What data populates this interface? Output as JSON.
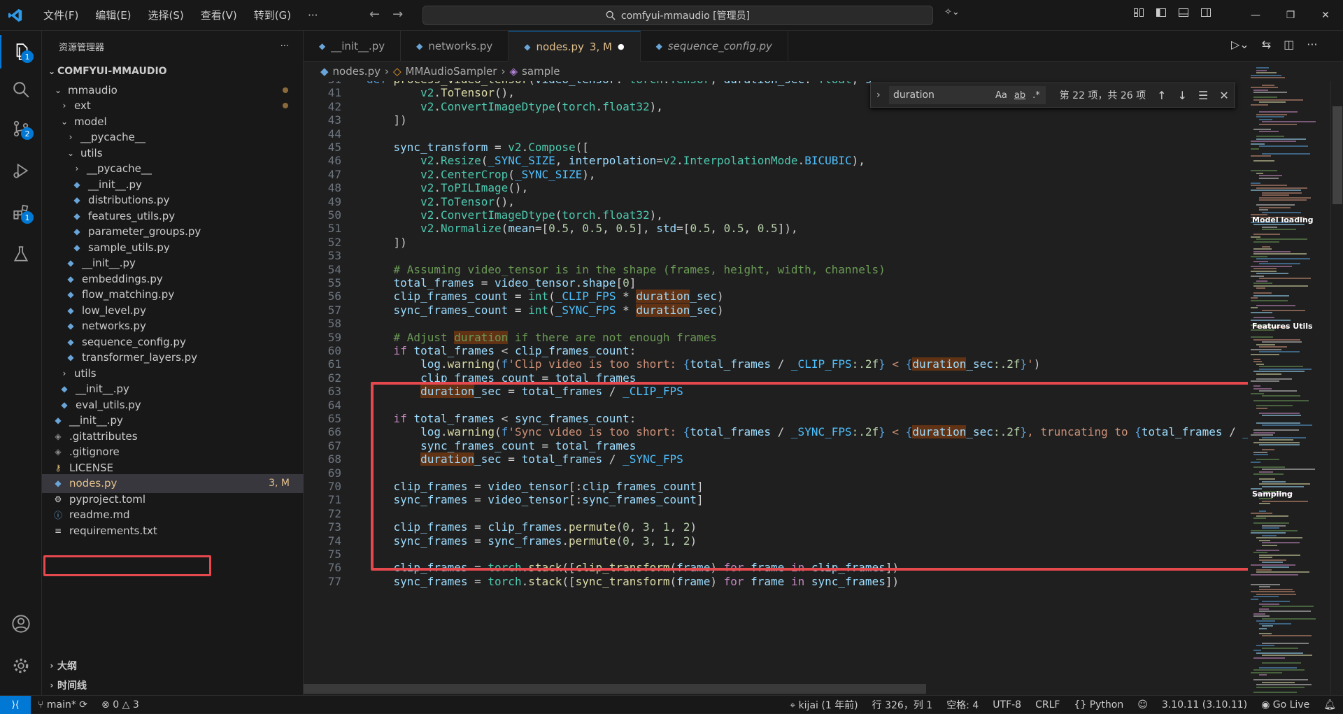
{
  "titlebar": {
    "menu": [
      "文件(F)",
      "编辑(E)",
      "选择(S)",
      "查看(V)",
      "转到(G)",
      "···"
    ],
    "search": "comfyui-mmaudio [管理员]"
  },
  "activity_badges": {
    "explorer": "1",
    "scm": "2",
    "extensions": "1"
  },
  "sidebar": {
    "title": "资源管理器",
    "more": "···",
    "root": "COMFYUI-MMAUDIO",
    "items": [
      {
        "label": "mmaudio",
        "indent": 1,
        "type": "folder-open",
        "dot": true
      },
      {
        "label": "ext",
        "indent": 2,
        "type": "folder",
        "dot": true
      },
      {
        "label": "model",
        "indent": 2,
        "type": "folder-open"
      },
      {
        "label": "__pycache__",
        "indent": 3,
        "type": "folder"
      },
      {
        "label": "utils",
        "indent": 3,
        "type": "folder-open"
      },
      {
        "label": "__pycache__",
        "indent": 4,
        "type": "folder"
      },
      {
        "label": "__init__.py",
        "indent": 4,
        "type": "py"
      },
      {
        "label": "distributions.py",
        "indent": 4,
        "type": "py"
      },
      {
        "label": "features_utils.py",
        "indent": 4,
        "type": "py"
      },
      {
        "label": "parameter_groups.py",
        "indent": 4,
        "type": "py"
      },
      {
        "label": "sample_utils.py",
        "indent": 4,
        "type": "py"
      },
      {
        "label": "__init__.py",
        "indent": 3,
        "type": "py"
      },
      {
        "label": "embeddings.py",
        "indent": 3,
        "type": "py"
      },
      {
        "label": "flow_matching.py",
        "indent": 3,
        "type": "py"
      },
      {
        "label": "low_level.py",
        "indent": 3,
        "type": "py"
      },
      {
        "label": "networks.py",
        "indent": 3,
        "type": "py"
      },
      {
        "label": "sequence_config.py",
        "indent": 3,
        "type": "py"
      },
      {
        "label": "transformer_layers.py",
        "indent": 3,
        "type": "py"
      },
      {
        "label": "utils",
        "indent": 2,
        "type": "folder"
      },
      {
        "label": "__init__.py",
        "indent": 2,
        "type": "py"
      },
      {
        "label": "eval_utils.py",
        "indent": 2,
        "type": "py"
      },
      {
        "label": "__init__.py",
        "indent": 1,
        "type": "py"
      },
      {
        "label": ".gitattributes",
        "indent": 1,
        "type": "git"
      },
      {
        "label": ".gitignore",
        "indent": 1,
        "type": "git"
      },
      {
        "label": "LICENSE",
        "indent": 1,
        "type": "license"
      },
      {
        "label": "nodes.py",
        "indent": 1,
        "type": "py",
        "selected": true,
        "status": "3, M"
      },
      {
        "label": "pyproject.toml",
        "indent": 1,
        "type": "gear"
      },
      {
        "label": "readme.md",
        "indent": 1,
        "type": "info"
      },
      {
        "label": "requirements.txt",
        "indent": 1,
        "type": "txt"
      }
    ],
    "outline": "大纲",
    "timeline": "时间线"
  },
  "tabs": [
    {
      "label": "__init__.py"
    },
    {
      "label": "networks.py"
    },
    {
      "label": "nodes.py",
      "status": "3, M",
      "active": true
    },
    {
      "label": "sequence_config.py",
      "italic": true
    }
  ],
  "breadcrumb": [
    "nodes.py",
    "MMAudioSampler",
    "sample"
  ],
  "find": {
    "query": "duration",
    "result": "第 22 项，共 26 项",
    "opts": [
      "Aa",
      "ab",
      ".*"
    ]
  },
  "code": [
    {
      "n": "31",
      "h": "<span class='kw'>def</span> <span class='fn'>process_video_tensor</span>(<span class='var'>video_tensor</span>: <span class='cls'>torch</span>.<span class='cls'>Tensor</span>, <span class='var'>duration_sec</span>: <span class='cls'>float</span>, <span class='var'>s</span>"
    },
    {
      "n": "41",
      "h": "        <span class='cls'>v2</span>.<span class='fn'>ToTensor</span>(),"
    },
    {
      "n": "42",
      "h": "        <span class='cls'>v2</span>.<span class='cls'>ConvertImageDtype</span>(<span class='cls'>torch</span>.<span class='cls'>float32</span>),"
    },
    {
      "n": "43",
      "h": "    ])"
    },
    {
      "n": "44",
      "h": ""
    },
    {
      "n": "45",
      "h": "    <span class='var'>sync_transform</span> = <span class='cls'>v2</span>.<span class='cls'>Compose</span>(["
    },
    {
      "n": "46",
      "h": "        <span class='cls'>v2</span>.<span class='cls'>Resize</span>(<span class='const'>_SYNC_SIZE</span>, <span class='var'>interpolation</span>=<span class='cls'>v2</span>.<span class='cls'>InterpolationMode</span>.<span class='const'>BICUBIC</span>),"
    },
    {
      "n": "47",
      "h": "        <span class='cls'>v2</span>.<span class='cls'>CenterCrop</span>(<span class='const'>_SYNC_SIZE</span>),"
    },
    {
      "n": "48",
      "h": "        <span class='cls'>v2</span>.<span class='cls'>ToPILImage</span>(),"
    },
    {
      "n": "49",
      "h": "        <span class='cls'>v2</span>.<span class='cls'>ToTensor</span>(),"
    },
    {
      "n": "50",
      "h": "        <span class='cls'>v2</span>.<span class='cls'>ConvertImageDtype</span>(<span class='cls'>torch</span>.<span class='cls'>float32</span>),"
    },
    {
      "n": "51",
      "h": "        <span class='cls'>v2</span>.<span class='cls'>Normalize</span>(<span class='var'>mean</span>=[<span class='num'>0.5</span>, <span class='num'>0.5</span>, <span class='num'>0.5</span>], <span class='var'>std</span>=[<span class='num'>0.5</span>, <span class='num'>0.5</span>, <span class='num'>0.5</span>]),"
    },
    {
      "n": "52",
      "h": "    ])"
    },
    {
      "n": "53",
      "h": ""
    },
    {
      "n": "54",
      "h": "    <span class='cmt'># Assuming video_tensor is in the shape (frames, height, width, channels)</span>"
    },
    {
      "n": "55",
      "h": "    <span class='var'>total_frames</span> = <span class='var'>video_tensor</span>.<span class='var'>shape</span>[<span class='num'>0</span>]"
    },
    {
      "n": "56",
      "h": "    <span class='var'>clip_frames_count</span> = <span class='cls'>int</span>(<span class='const'>_CLIP_FPS</span> * <span class='var match'>duration</span><span class='var'>_sec</span>)"
    },
    {
      "n": "57",
      "h": "    <span class='var'>sync_frames_count</span> = <span class='cls'>int</span>(<span class='const'>_SYNC_FPS</span> * <span class='var match'>duration</span><span class='var'>_sec</span>)"
    },
    {
      "n": "58",
      "h": ""
    },
    {
      "n": "59",
      "h": "    <span class='cmt'># Adjust </span><span class='cmt match'>duration</span><span class='cmt'> if there are not enough frames</span>"
    },
    {
      "n": "60",
      "h": "    <span class='ctl'>if</span> <span class='var'>total_frames</span> &lt; <span class='var'>clip_frames_count</span>:"
    },
    {
      "n": "61",
      "h": "        <span class='var'>log</span>.<span class='fn'>warning</span>(<span class='kw'>f</span><span class='str'>'Clip video is too short: </span><span class='kw'>{</span><span class='var'>total_frames</span> / <span class='const'>_CLIP_FPS</span><span class='num'>:.2f</span><span class='kw'>}</span><span class='str'> &lt; </span><span class='kw'>{</span><span class='var match'>duration</span><span class='var'>_sec</span><span class='num'>:.2f</span><span class='kw'>}</span><span class='str'>'</span>)"
    },
    {
      "n": "62",
      "h": "        <span class='var'>clip_frames_count</span> = <span class='var'>total_frames</span>"
    },
    {
      "n": "63",
      "h": "        <span class='var match'>duration</span><span class='var'>_sec</span> = <span class='var'>total_frames</span> / <span class='const'>_CLIP_FPS</span>"
    },
    {
      "n": "64",
      "h": ""
    },
    {
      "n": "65",
      "h": "    <span class='ctl'>if</span> <span class='var'>total_frames</span> &lt; <span class='var'>sync_frames_count</span>:"
    },
    {
      "n": "66",
      "h": "        <span class='var'>log</span>.<span class='fn'>warning</span>(<span class='kw'>f</span><span class='str'>'Sync video is too short: </span><span class='kw'>{</span><span class='var'>total_frames</span> / <span class='const'>_SYNC_FPS</span><span class='num'>:.2f</span><span class='kw'>}</span><span class='str'> &lt; </span><span class='kw'>{</span><span class='var match'>duration</span><span class='var'>_sec</span><span class='num'>:.2f</span><span class='kw'>}</span><span class='str'>, truncating to </span><span class='kw'>{</span><span class='var'>total_frames</span> / <span class='const'>_S</span>"
    },
    {
      "n": "67",
      "h": "        <span class='var'>sync_frames_count</span> = <span class='var'>total_frames</span>"
    },
    {
      "n": "68",
      "h": "        <span class='var match'>duration</span><span class='var'>_sec</span> = <span class='var'>total_frames</span> / <span class='const'>_SYNC_FPS</span>"
    },
    {
      "n": "69",
      "h": ""
    },
    {
      "n": "70",
      "h": "    <span class='var'>clip_frames</span> = <span class='var'>video_tensor</span>[:<span class='var'>clip_frames_count</span>]"
    },
    {
      "n": "71",
      "h": "    <span class='var'>sync_frames</span> = <span class='var'>video_tensor</span>[:<span class='var'>sync_frames_count</span>]"
    },
    {
      "n": "72",
      "h": ""
    },
    {
      "n": "73",
      "h": "    <span class='var'>clip_frames</span> = <span class='var'>clip_frames</span>.<span class='fn'>permute</span>(<span class='num'>0</span>, <span class='num'>3</span>, <span class='num'>1</span>, <span class='num'>2</span>)"
    },
    {
      "n": "74",
      "h": "    <span class='var'>sync_frames</span> = <span class='var'>sync_frames</span>.<span class='fn'>permute</span>(<span class='num'>0</span>, <span class='num'>3</span>, <span class='num'>1</span>, <span class='num'>2</span>)"
    },
    {
      "n": "75",
      "h": ""
    },
    {
      "n": "76",
      "h": "    <span class='var'>clip_frames</span> = <span class='cls'>torch</span>.<span class='fn'>stack</span>([<span class='fn'>clip_transform</span>(<span class='var'>frame</span>) <span class='ctl'>for</span> <span class='var'>frame</span> <span class='ctl'>in</span> <span class='var'>clip_frames</span>])"
    },
    {
      "n": "77",
      "h": "    <span class='var'>sync_frames</span> = <span class='cls'>torch</span>.<span class='fn'>stack</span>([<span class='fn'>sync_transform</span>(<span class='var'>frame</span>) <span class='ctl'>for</span> <span class='var'>frame</span> <span class='ctl'>in</span> <span class='var'>sync_frames</span>])"
    }
  ],
  "minimap_labels": [
    "Model loading",
    "Features Utils",
    "Sampling"
  ],
  "statusbar": {
    "branch": "main*",
    "problems_errors": "0",
    "problems_warnings": "3",
    "author": "kijai (1 年前)",
    "position": "行 326，列 1",
    "indent": "空格: 4",
    "encoding": "UTF-8",
    "eol": "CRLF",
    "language": "Python",
    "interpreter": "3.10.11 (3.10.11)",
    "golive": "Go Live"
  },
  "colors": {
    "accent": "#0078d4",
    "highlight": "#e5484d",
    "match": "#613214"
  }
}
